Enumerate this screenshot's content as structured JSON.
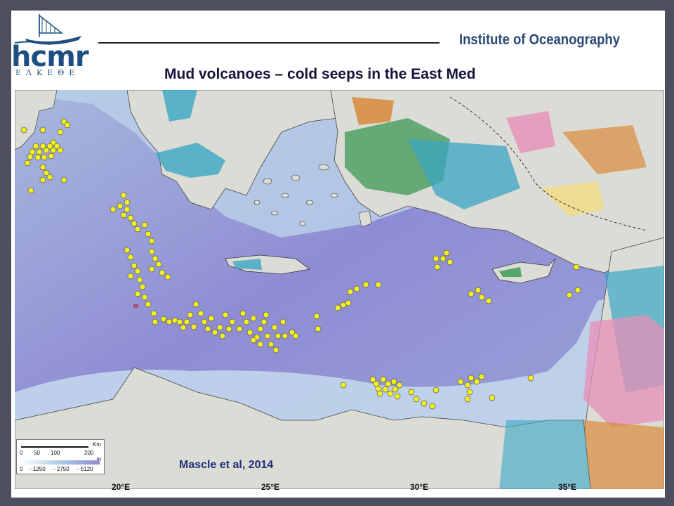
{
  "header": {
    "logo_text": "hcmr",
    "logo_subtext": "ΕΛΚΕΘΕ",
    "institute": "Institute  of  Oceanography"
  },
  "title": "Mud volcanoes – cold seeps in the East Med",
  "map": {
    "longitude_labels": [
      "20°E",
      "25°E",
      "30°E",
      "35°E"
    ],
    "citation": "Mascle et al, 2014",
    "scale": {
      "unit_km": "Km",
      "km_ticks": [
        "0",
        "50",
        "100",
        "200"
      ],
      "unit_m": "m",
      "depth_ticks": [
        "0",
        "- 1250",
        "- 2750",
        "- 5120"
      ]
    },
    "marker_color": "#f3f022",
    "colors": {
      "deep_sea": "#8f8cd4",
      "shelf": "#a9cbe5",
      "land_light": "#dcdcd6",
      "geology_teal": "#3aa6c4",
      "geology_green": "#3d9a55",
      "geology_orange": "#d88a3a",
      "geology_pink": "#e78fb6"
    }
  }
}
